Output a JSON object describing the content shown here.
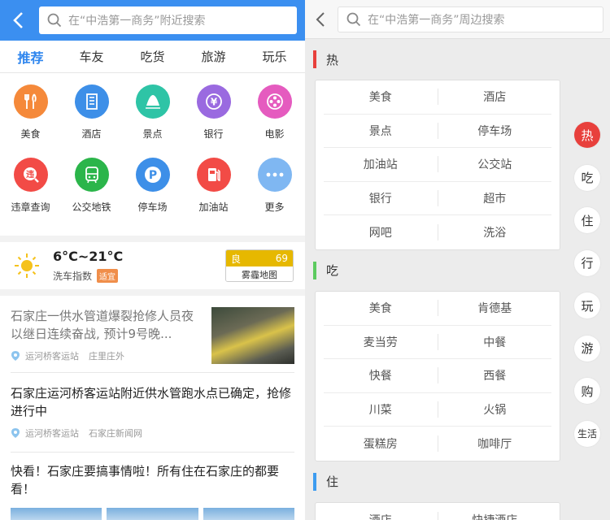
{
  "left": {
    "search_placeholder": "在“中浩第一商务”附近搜索",
    "tabs": [
      {
        "label": "推荐",
        "active": true
      },
      {
        "label": "车友",
        "active": false
      },
      {
        "label": "吃货",
        "active": false
      },
      {
        "label": "旅游",
        "active": false
      },
      {
        "label": "玩乐",
        "active": false
      }
    ],
    "grid": [
      {
        "label": "美食",
        "icon": "fork-knife-icon",
        "color": "#f5893a",
        "glyph": "🍴"
      },
      {
        "label": "酒店",
        "icon": "building-icon",
        "color": "#3d8fe8",
        "glyph": "▦"
      },
      {
        "label": "景点",
        "icon": "mountain-icon",
        "color": "#2ec4a6",
        "glyph": "▲"
      },
      {
        "label": "银行",
        "icon": "yen-coin-icon",
        "color": "#9a6ae0",
        "glyph": "¥"
      },
      {
        "label": "电影",
        "icon": "film-reel-icon",
        "color": "#e55bbf",
        "glyph": "✽"
      },
      {
        "label": "违章查询",
        "icon": "violation-icon",
        "color": "#f24b46",
        "glyph": "违"
      },
      {
        "label": "公交地铁",
        "icon": "bus-icon",
        "color": "#2bb54a",
        "glyph": "▭"
      },
      {
        "label": "停车场",
        "icon": "parking-icon",
        "color": "#3d8fe8",
        "glyph": "P"
      },
      {
        "label": "加油站",
        "icon": "gas-station-icon",
        "color": "#f24b46",
        "glyph": "⛽"
      },
      {
        "label": "更多",
        "icon": "more-dots-icon",
        "color": "#7fb7f2",
        "glyph": "•••"
      }
    ],
    "weather": {
      "temp": "6°C~21°C",
      "wash_label": "洗车指数",
      "wash_tag": "适宜",
      "aqi_level": "良",
      "aqi_value": "69",
      "haze_map": "雾霾地图"
    },
    "news": [
      {
        "title": "石家庄一供水管道爆裂抢修人员夜以继日连续奋战, 预计9号晚...",
        "place": "运河桥客运站",
        "source": "庄里庄外"
      },
      {
        "title": "石家庄运河桥客运站附近供水管跑水点已确定，抢修进行中",
        "place": "运河桥客运站",
        "source": "石家庄新闻网"
      },
      {
        "title": "快看！石家庄要搞事情啦！所有住在石家庄的都要看！"
      }
    ]
  },
  "right": {
    "search_placeholder": "在“中浩第一商务”周边搜索",
    "sections": [
      {
        "title": "热",
        "color": "#e8403c",
        "rows": [
          [
            "美食",
            "酒店"
          ],
          [
            "景点",
            "停车场"
          ],
          [
            "加油站",
            "公交站"
          ],
          [
            "银行",
            "超市"
          ],
          [
            "网吧",
            "洗浴"
          ]
        ]
      },
      {
        "title": "吃",
        "color": "#5ccb5f",
        "rows": [
          [
            "美食",
            "肯德基"
          ],
          [
            "麦当劳",
            "中餐"
          ],
          [
            "快餐",
            "西餐"
          ],
          [
            "川菜",
            "火锅"
          ],
          [
            "蛋糕房",
            "咖啡厅"
          ]
        ]
      },
      {
        "title": "住",
        "color": "#3d9cf0",
        "rows": [
          [
            "酒店",
            "快捷酒店"
          ]
        ]
      }
    ],
    "index": [
      "热",
      "吃",
      "住",
      "行",
      "玩",
      "游",
      "购",
      "生活"
    ]
  }
}
